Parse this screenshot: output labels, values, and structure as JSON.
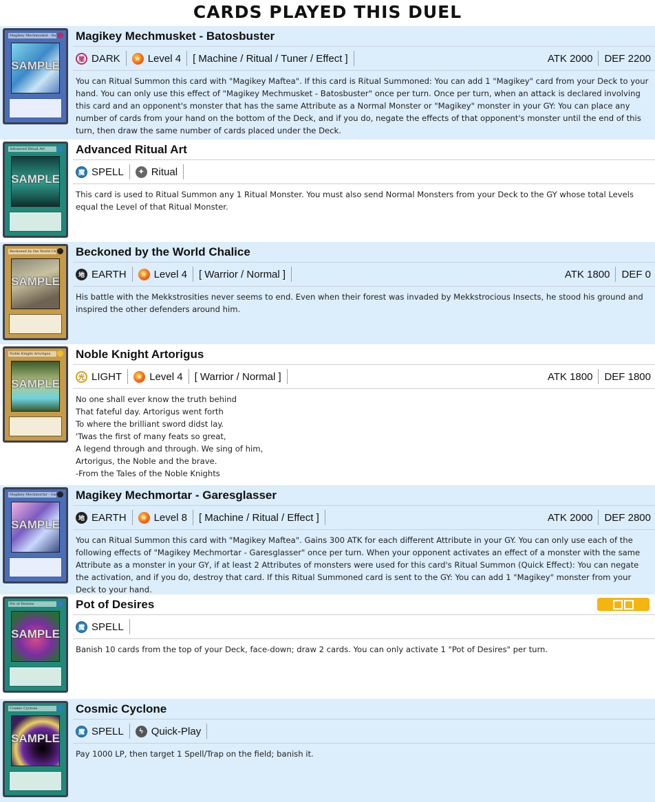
{
  "page": {
    "title": "CARDS PLAYED THIS DUEL"
  },
  "cards": [
    {
      "name": "Magikey Mechmusket - Batosbuster",
      "thumb_name": "Magikey Mechmusket - Batosbuster",
      "watermark": "SAMPLE",
      "attribute": "DARK",
      "level": "Level 4",
      "types": "[ Machine / Ritual / Tuner / Effect ]",
      "atk": "ATK 2000",
      "def": "DEF 2200",
      "description": "You can Ritual Summon this card with \"Magikey Maftea\". If this card is Ritual Summoned: You can add 1 \"Magikey\" card from your Deck to your hand. You can only use this effect of \"Magikey Mechmusket - Batosbuster\" once per turn. Once per turn, when an attack is declared involving this card and an opponent's monster that has the same Attribute as a Normal Monster or \"Magikey\" monster in your GY: You can place any number of cards from your hand on the bottom of the Deck, and if you do, negate the effects of that opponent's monster until the end of this turn, then draw the same number of cards placed under the Deck."
    },
    {
      "name": "Advanced Ritual Art",
      "thumb_name": "Advanced Ritual Art",
      "watermark": "SAMPLE",
      "card_kind": "SPELL",
      "spell_type": "Ritual",
      "description": "This card is used to Ritual Summon any 1 Ritual Monster. You must also send Normal Monsters from your Deck to the GY whose total Levels equal the Level of that Ritual Monster."
    },
    {
      "name": "Beckoned by the World Chalice",
      "thumb_name": "Beckoned by the World Chalice",
      "watermark": "SAMPLE",
      "attribute": "EARTH",
      "level": "Level 4",
      "types": "[ Warrior / Normal ]",
      "atk": "ATK 1800",
      "def": "DEF 0",
      "description": "His battle with the Mekkstrosities never seems to end. Even when their forest was invaded by Mekkstrocious Insects, he stood his ground and inspired the other defenders around him."
    },
    {
      "name": "Noble Knight Artorigus",
      "thumb_name": "Noble Knight Artorigus",
      "watermark": "SAMPLE",
      "attribute": "LIGHT",
      "level": "Level 4",
      "types": "[ Warrior / Normal ]",
      "atk": "ATK 1800",
      "def": "DEF 1800",
      "lines": [
        "No one shall ever know the truth behind",
        "That fateful day. Artorigus went forth",
        "To where the brilliant sword didst lay.",
        "'Twas the first of many feats so great,",
        "A legend through and through. We sing of him,",
        "Artorigus, the Noble and the brave.",
        "-From the Tales of the Noble Knights"
      ]
    },
    {
      "name": "Magikey Mechmortar - Garesglasser",
      "thumb_name": "Magikey Mechmortar - Garesglasser",
      "watermark": "SAMPLE",
      "attribute": "EARTH",
      "level": "Level 8",
      "types": "[ Machine / Ritual / Effect ]",
      "atk": "ATK 2000",
      "def": "DEF 2800",
      "description": "You can Ritual Summon this card with \"Magikey Maftea\". Gains 300 ATK for each different Attribute in your GY. You can only use each of the following effects of \"Magikey Mechmortar - Garesglasser\" once per turn. When your opponent activates an effect of a monster with the same Attribute as a monster in your GY, if at least 2 Attributes of monsters were used for this card's Ritual Summon (Quick Effect): You can negate the activation, and if you do, destroy that card. If this Ritual Summoned card is sent to the GY: You can add 1 \"Magikey\" monster from your Deck to your hand."
    },
    {
      "name": "Pot of Desires",
      "thumb_name": "Pot of Desires",
      "watermark": "SAMPLE",
      "card_kind": "SPELL",
      "limit_badge": "semi-limited-badge-icon",
      "description": "Banish 10 cards from the top of your Deck, face-down; draw 2 cards. You can only activate 1 \"Pot of Desires\" per turn."
    },
    {
      "name": "Cosmic Cyclone",
      "thumb_name": "Cosmic Cyclone",
      "watermark": "SAMPLE",
      "card_kind": "SPELL",
      "spell_type": "Quick-Play",
      "description": "Pay 1000 LP, then target 1 Spell/Trap on the field; banish it."
    }
  ],
  "icons": {
    "dark": "dark-attribute-icon",
    "earth": "earth-attribute-icon",
    "light": "light-attribute-icon",
    "level": "level-star-icon",
    "spell": "spell-icon",
    "ritual": "ritual-icon",
    "quick": "quick-play-icon"
  },
  "colors": {
    "row_tint": "#dcedfb",
    "row_plain": "#ffffff",
    "badge": "#f5b40f"
  }
}
